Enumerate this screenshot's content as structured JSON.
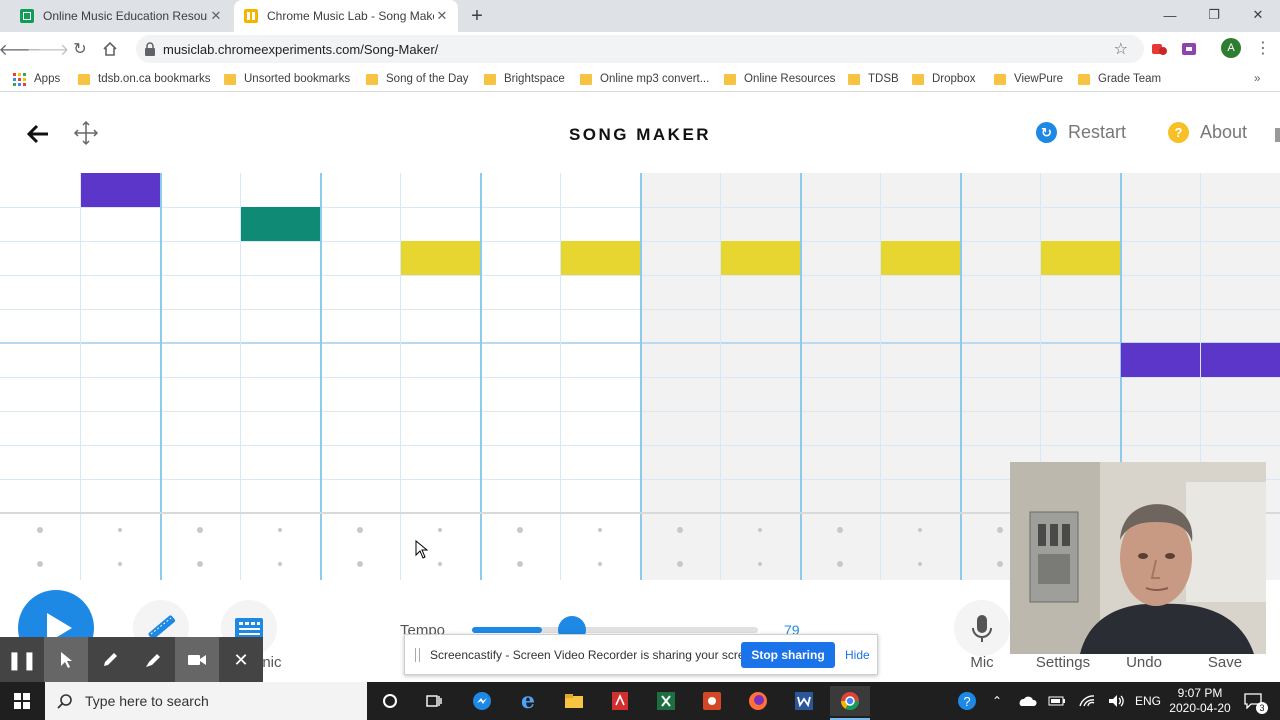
{
  "browser": {
    "tabs": [
      {
        "title": "Online Music Education Resource",
        "active": false,
        "favicon_color": "#0f9d58"
      },
      {
        "title": "Chrome Music Lab - Song Maker",
        "active": true,
        "favicon_color": "#f4b400"
      }
    ],
    "new_tab_label": "+",
    "url": "musiclab.chromeexperiments.com/Song-Maker/",
    "profile_initial": "A"
  },
  "bookmarks": [
    {
      "label": "Apps",
      "type": "apps"
    },
    {
      "label": "tdsb.on.ca bookmarks",
      "type": "folder"
    },
    {
      "label": "Unsorted bookmarks",
      "type": "folder"
    },
    {
      "label": "Song of the Day",
      "type": "folder"
    },
    {
      "label": "Brightspace",
      "type": "folder"
    },
    {
      "label": "Online mp3 convert...",
      "type": "folder"
    },
    {
      "label": "Online Resources",
      "type": "folder"
    },
    {
      "label": "TDSB",
      "type": "folder"
    },
    {
      "label": "Dropbox",
      "type": "folder"
    },
    {
      "label": "ViewPure",
      "type": "folder"
    },
    {
      "label": "Grade Team",
      "type": "folder"
    }
  ],
  "songmaker": {
    "title": "SONG MAKER",
    "restart_label": "Restart",
    "about_label": "About",
    "notes": [
      {
        "col": 1,
        "row": 0,
        "color": "#5c35c9"
      },
      {
        "col": 3,
        "row": 1,
        "color": "#0f8a74"
      },
      {
        "col": 5,
        "row": 2,
        "color": "#e8d630"
      },
      {
        "col": 7,
        "row": 2,
        "color": "#e8d630"
      },
      {
        "col": 9,
        "row": 2,
        "color": "#e8d630"
      },
      {
        "col": 11,
        "row": 2,
        "color": "#e8d630"
      },
      {
        "col": 13,
        "row": 2,
        "color": "#e8d630"
      },
      {
        "col": 14,
        "row": 5,
        "color": "#5c35c9"
      },
      {
        "col": 15,
        "row": 5,
        "color": "#5c35c9"
      }
    ],
    "controls": {
      "instrument_partial_label": "onic",
      "tempo_label": "Tempo",
      "tempo_value": "79",
      "mic_label": "Mic",
      "settings_label": "Settings",
      "undo_label": "Undo",
      "save_label": "Save"
    }
  },
  "screencastify": {
    "message": "Screencastify - Screen Video Recorder is sharing your screen.",
    "stop_label": "Stop sharing",
    "hide_label": "Hide"
  },
  "taskbar": {
    "search_placeholder": "Type here to search",
    "language": "ENG",
    "time": "9:07 PM",
    "date": "2020-04-20",
    "notification_count": "3"
  },
  "colors": {
    "accent_blue": "#1e88e5",
    "restart_icon": "#1e88e5",
    "about_icon": "#f6c026"
  }
}
